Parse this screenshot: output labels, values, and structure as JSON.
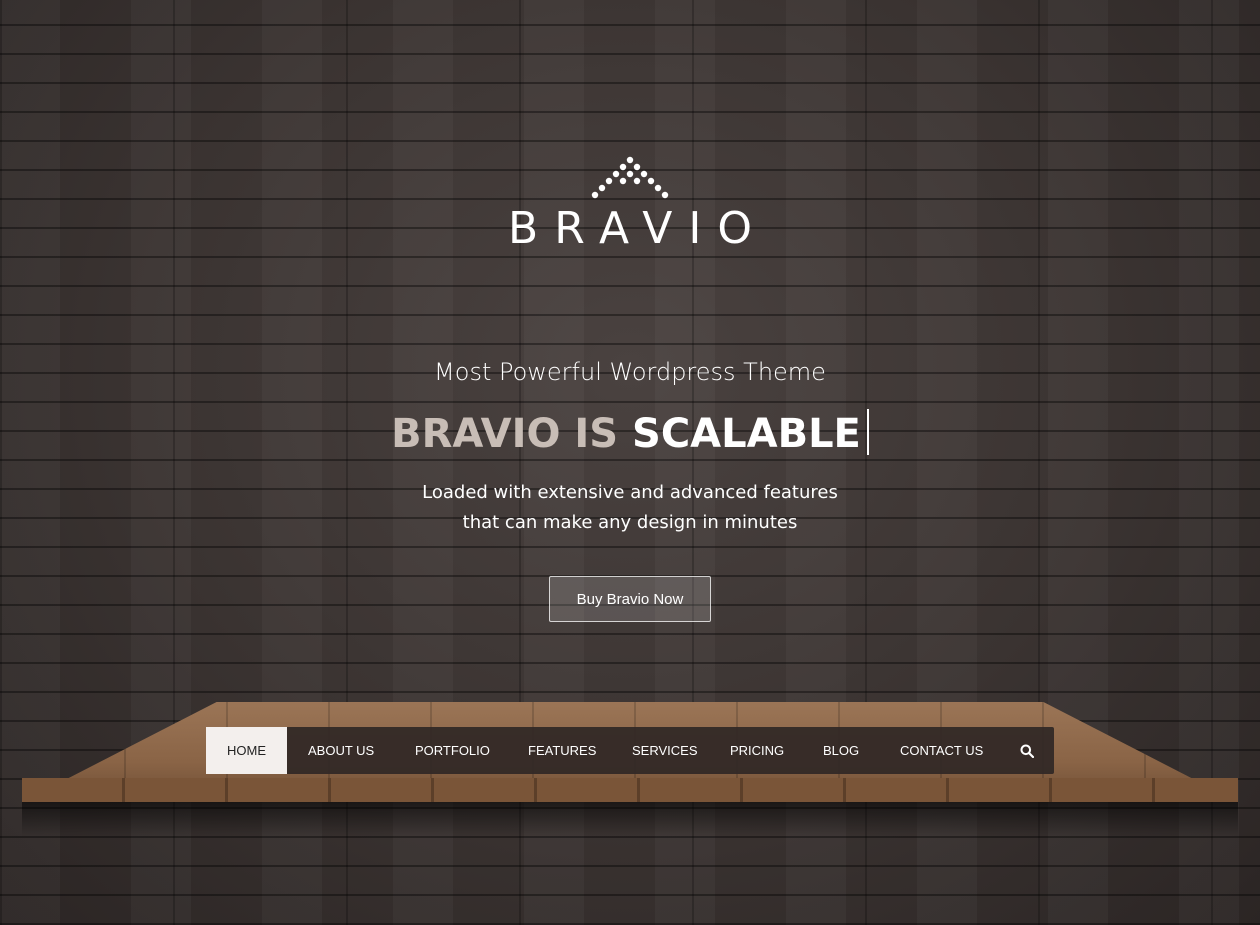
{
  "brand": {
    "name": "BRAVIO",
    "logo_icon": "dotted-triangle-icon"
  },
  "hero": {
    "tagline": "Most Powerful Wordpress Theme",
    "headline_part1": "BRAVIO IS ",
    "headline_part2": "SCALABLE",
    "description_line1": "Loaded with extensive and advanced features",
    "description_line2": "that can make any design in minutes",
    "cta_label": "Buy Bravio Now"
  },
  "nav": {
    "items": [
      {
        "label": "HOME",
        "active": true
      },
      {
        "label": "ABOUT US"
      },
      {
        "label": "PORTFOLIO"
      },
      {
        "label": "FEATURES"
      },
      {
        "label": "SERVICES"
      },
      {
        "label": "PRICING"
      },
      {
        "label": "BLOG"
      },
      {
        "label": "CONTACT US"
      }
    ],
    "search_icon": "search-icon"
  },
  "colors": {
    "nav_background": "#302826",
    "nav_active_background": "#f3efed",
    "headline_muted": "#c8bdb6",
    "text_light": "#ffffff"
  }
}
